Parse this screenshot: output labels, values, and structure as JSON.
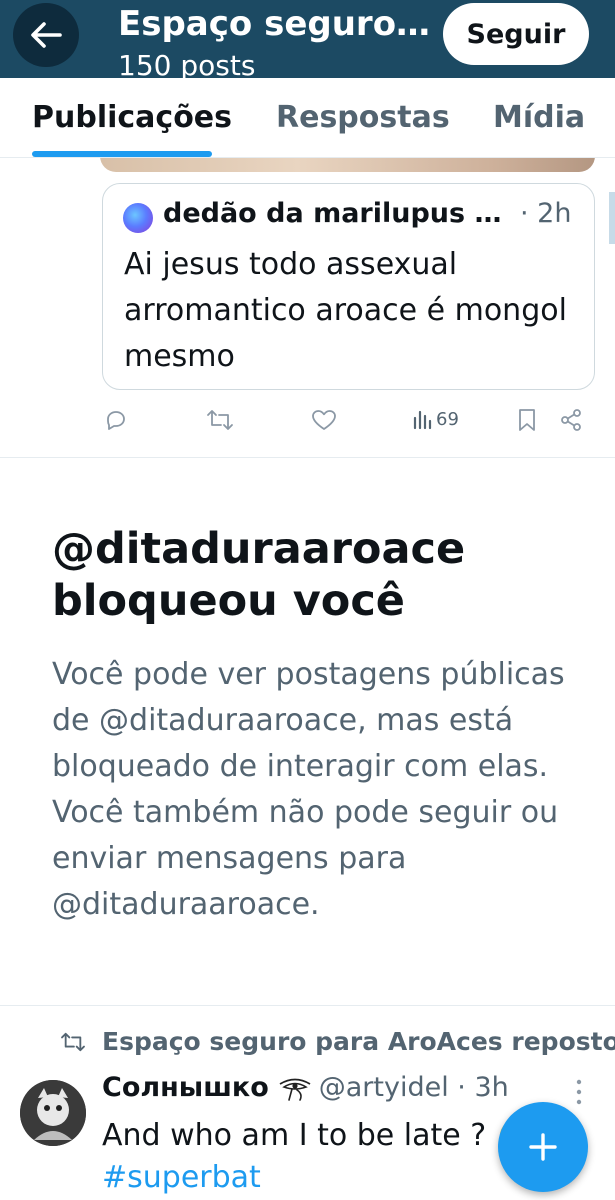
{
  "header": {
    "title": "Espaço seguro…",
    "subtitle": "150 posts",
    "follow_label": "Seguir"
  },
  "tabs": [
    {
      "label": "Publicações",
      "active": true
    },
    {
      "label": "Respostas",
      "active": false
    },
    {
      "label": "Mídia",
      "active": false
    }
  ],
  "quoted_tweet": {
    "author": "dedão da marilupus …",
    "time": "· 2h",
    "text": "Ai jesus todo assexual arromantico aroace é mongol mesmo"
  },
  "actions": {
    "icons": [
      "reply-icon",
      "retweet-icon",
      "like-icon",
      "views-icon",
      "bookmark-icon",
      "share-icon"
    ],
    "views": "69"
  },
  "blocked_notice": {
    "title": "@ditaduraaroace bloqueou você",
    "description": "Você pode ver postagens públicas de @ditaduraaroace, mas está bloqueado de interagir com elas. Você também não pode seguir ou enviar mensagens para @ditaduraaroace."
  },
  "repost": {
    "label": "Espaço seguro para AroAces repostou"
  },
  "tweet": {
    "name": "Солнышко",
    "name_icon": "eye-of-horus-icon",
    "handle": "@artyidel · 3h",
    "text": "And who am I to be late ?",
    "emoji": "laughing-emoji",
    "hashtag": "#superbat"
  },
  "colors": {
    "header_bg": "#1c4a63",
    "accent": "#1d9bf0",
    "text_primary": "#0f1419",
    "text_secondary": "#536471"
  }
}
